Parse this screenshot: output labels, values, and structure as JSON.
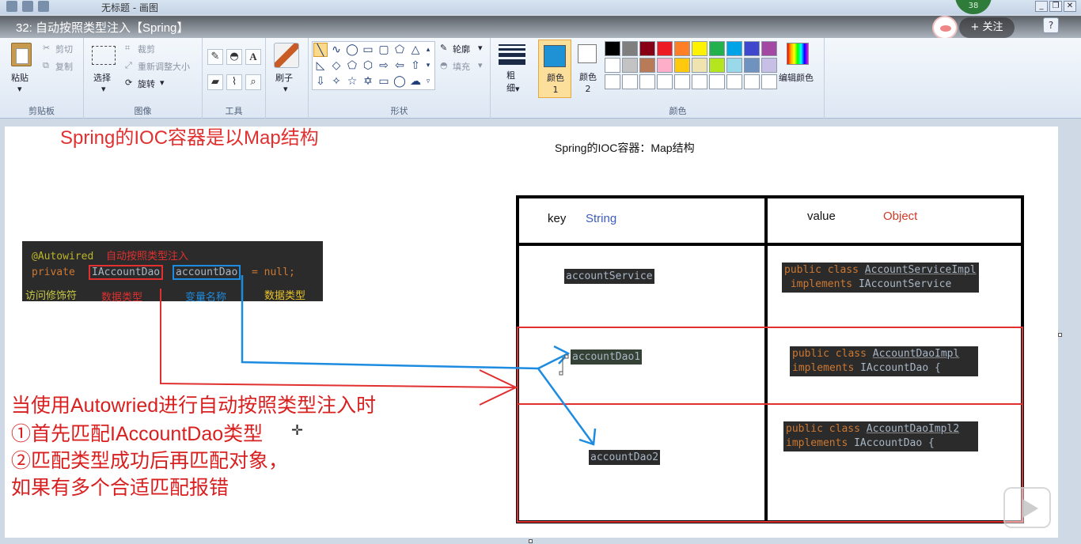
{
  "window": {
    "title": "无标题 - 画图",
    "controls": [
      "_",
      "❐",
      "✕"
    ]
  },
  "video": {
    "title": "32: 自动按照类型注入【Spring】",
    "badge": "38",
    "follow_label": "+ 关注",
    "help_label": "?"
  },
  "ribbon": {
    "clipboard": {
      "paste": "粘贴",
      "cut": "剪切",
      "copy": "复制",
      "label": "剪贴板"
    },
    "image": {
      "select": "选择",
      "crop": "裁剪",
      "resize": "重新调整大小",
      "rotate": "旋转",
      "label": "图像"
    },
    "tools": {
      "label": "工具",
      "text_tool": "A"
    },
    "brushes": {
      "label": "刷子"
    },
    "shapes": {
      "outline": "轮廓",
      "fill": "填充",
      "label": "形状"
    },
    "size": {
      "label": "粗\n细"
    },
    "colors": {
      "color1": "颜色 1",
      "color2": "颜色 2",
      "edit": "编辑颜色",
      "label": "颜色",
      "color1_value": "#1f92d6",
      "palette": [
        "#000000",
        "#7f7f7f",
        "#880015",
        "#ed1c24",
        "#ff7f27",
        "#fff200",
        "#22b14c",
        "#00a2e8",
        "#3f48cc",
        "#a349a4",
        "#ffffff",
        "#c3c3c3",
        "#b97a57",
        "#ffaec9",
        "#ffc90e",
        "#efe4b0",
        "#b5e61d",
        "#99d9ea",
        "#7092be",
        "#c8bfe7",
        "#ffffff",
        "#ffffff",
        "#ffffff",
        "#ffffff",
        "#ffffff",
        "#ffffff",
        "#ffffff",
        "#ffffff",
        "#ffffff",
        "#ffffff"
      ]
    }
  },
  "canvas": {
    "heading": "Spring的IOC容器是以Map结构",
    "diagram_title": "Spring的IOC容器：Map结构",
    "code": {
      "annotation": "@Autowired",
      "annotation_note": "自动按照类型注入",
      "kw_private": "private",
      "type": "IAccountDao",
      "var": "accountDao",
      "rest": " = null;",
      "labels": [
        "访问修饰符",
        "数据类型",
        "变量名称",
        "数据类型"
      ]
    },
    "annotations": [
      "当使用Autowried进行自动按照类型注入时",
      "①首先匹配IAccountDao类型",
      "②匹配类型成功后再匹配对象，",
      "如果有多个合适匹配报错"
    ],
    "table": {
      "key_label": "key",
      "key_type": "String",
      "value_label": "value",
      "value_type": "Object",
      "rows": [
        {
          "key": "accountService",
          "v_kw": "public class",
          "v_cls": "AccountServiceImpl",
          "v_kw2": "implements",
          "v_if": "IAccountService"
        },
        {
          "key": "accountDao1",
          "v_kw": "public class",
          "v_cls": "AccountDaoImpl",
          "v_kw2": "implements",
          "v_if": "IAccountDao {"
        },
        {
          "key": "accountDao2",
          "v_kw": "public class",
          "v_cls": "AccountDaoImpl2",
          "v_kw2": "implements",
          "v_if": "IAccountDao {"
        }
      ]
    }
  }
}
